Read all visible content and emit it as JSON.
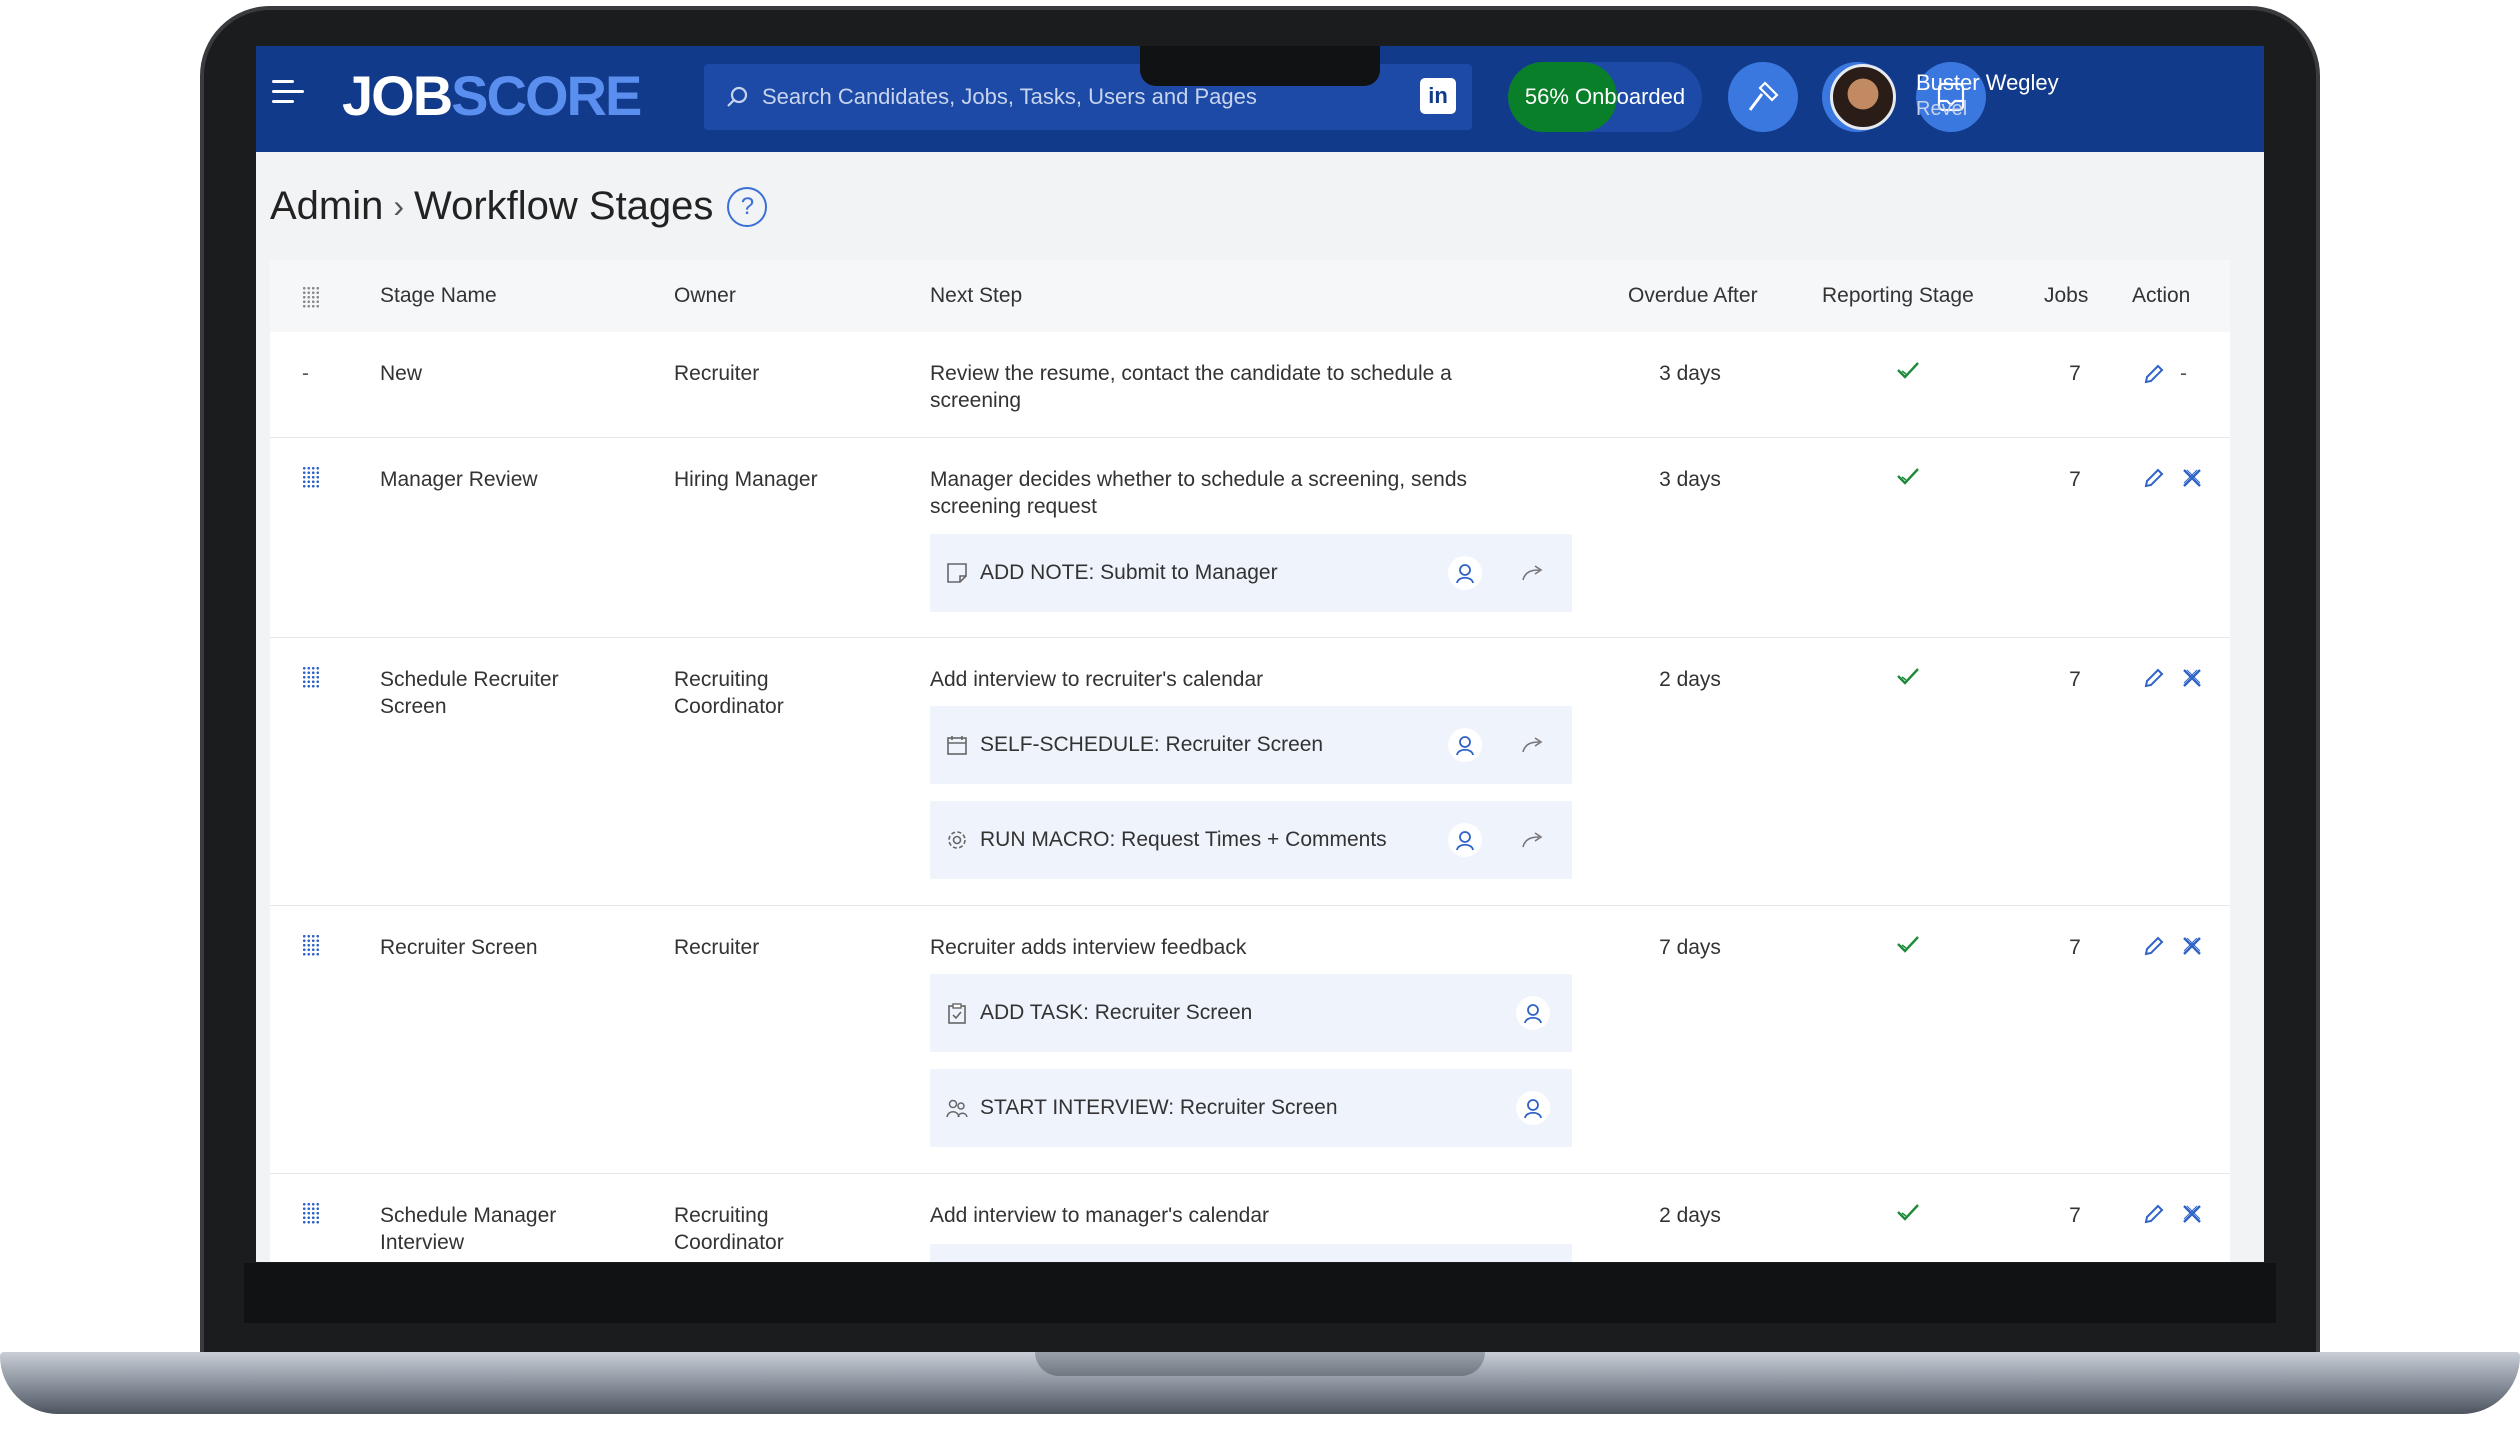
{
  "app": {
    "logo_part1": "JOB",
    "logo_part2": "SCORE",
    "search_placeholder": "Search Candidates, Jobs, Tasks, Users and Pages",
    "linkedin_label": "in",
    "onboarding": {
      "label": "56% Onboarded",
      "progress": 0.56
    },
    "user": {
      "name": "Buster Wegley",
      "org": "Revel"
    },
    "colors": {
      "nav": "#123a8a",
      "accent": "#3a78e0",
      "success": "#0a7f2a"
    }
  },
  "page": {
    "breadcrumb_root": "Admin",
    "breadcrumb_sep": "›",
    "title": "Workflow Stages",
    "help_label": "?"
  },
  "table": {
    "headers": {
      "stage_name": "Stage Name",
      "owner": "Owner",
      "next_step": "Next Step",
      "overdue_after": "Overdue After",
      "reporting_stage": "Reporting Stage",
      "jobs": "Jobs",
      "action": "Action"
    },
    "rows": [
      {
        "name": "New",
        "owner": "Recruiter",
        "next_step": "Review the resume, contact the candidate to schedule a screening",
        "overdue": "3 days",
        "jobs": "7",
        "grip": "-",
        "delete": "-",
        "steps": []
      },
      {
        "name": "Manager Review",
        "owner": "Hiring Manager",
        "next_step": "Manager decides whether to schedule a screening, sends screening request",
        "overdue": "3 days",
        "jobs": "7",
        "steps": [
          {
            "label": "ADD NOTE: Submit to Manager",
            "icon": "note-icon",
            "share": true
          }
        ]
      },
      {
        "name": "Schedule Recruiter Screen",
        "owner": "Recruiting Coordinator",
        "next_step": "Add interview to recruiter's calendar",
        "overdue": "2 days",
        "jobs": "7",
        "steps": [
          {
            "label": "SELF-SCHEDULE: Recruiter Screen",
            "icon": "calendar-icon",
            "share": true
          },
          {
            "label": "RUN MACRO: Request Times + Comments",
            "icon": "gear-icon",
            "share": true
          }
        ]
      },
      {
        "name": "Recruiter Screen",
        "owner": "Recruiter",
        "next_step": "Recruiter adds interview feedback",
        "overdue": "7 days",
        "jobs": "7",
        "steps": [
          {
            "label": "ADD TASK: Recruiter Screen",
            "icon": "clipboard-icon",
            "share": false
          },
          {
            "label": "START INTERVIEW: Recruiter Screen",
            "icon": "interview-icon",
            "share": false
          }
        ]
      },
      {
        "name": "Schedule Manager Interview",
        "owner": "Recruiting Coordinator",
        "next_step": "Add interview to manager's calendar",
        "overdue": "2 days",
        "jobs": "7",
        "steps": []
      }
    ]
  }
}
